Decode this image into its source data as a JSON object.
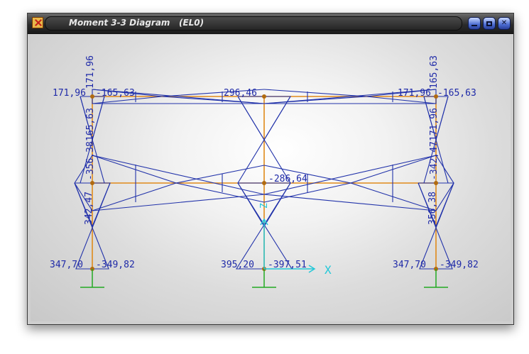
{
  "window": {
    "title": "Moment 3-3 Diagram   (EL0)",
    "icon": "app-star-icon",
    "buttons": [
      "minimize-icon",
      "maximize-icon",
      "close-icon"
    ]
  },
  "colors": {
    "diagram": "#2233aa",
    "frame": "#e08a1a",
    "node": "#b06a10",
    "support": "#22aa22",
    "axis": "#22c8d8",
    "label": "#1f2aa8"
  },
  "labels": {
    "top_left_1": "171,96",
    "top_left_2": "-165,63",
    "top_left_vert": "171,96",
    "top_mid": "296,46",
    "top_right_1": "171,96",
    "top_right_2": "-165,63",
    "top_right_vert": "165,63",
    "mid_center": "-286,64",
    "left_col_upper": "-356,38",
    "left_col_upper2": "165,63",
    "right_col_upper": "-342,47",
    "right_col_upper2": "171,96",
    "left_col_lower": "342,47",
    "right_col_lower": "356,38",
    "base_left_1": "347,70",
    "base_left_2": "-349,82",
    "base_mid_1": "395,20",
    "base_mid_2": "-397,51",
    "base_right_1": "347,70",
    "base_right_2": "-349,82",
    "axis_x": "X",
    "axis_z": "Z"
  }
}
